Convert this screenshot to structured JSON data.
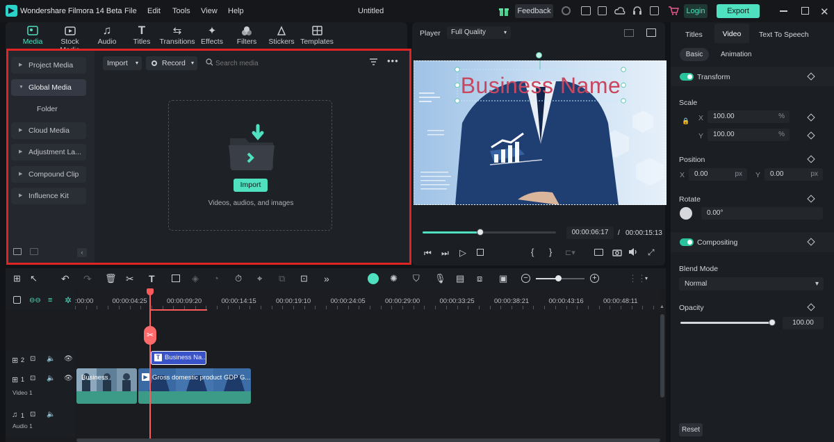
{
  "titlebar": {
    "app_title": "Wondershare Filmora 14 Beta",
    "menu": [
      "File",
      "Edit",
      "Tools",
      "View",
      "Help"
    ],
    "doc_title": "Untitled",
    "feedback": "Feedback",
    "login": "Login",
    "export": "Export"
  },
  "toolbar": {
    "tabs": [
      "Media",
      "Stock Media",
      "Audio",
      "Titles",
      "Transitions",
      "Effects",
      "Filters",
      "Stickers",
      "Templates"
    ]
  },
  "media": {
    "sidebar": [
      "Project Media",
      "Global Media",
      "Folder",
      "Cloud Media",
      "Adjustment La...",
      "Compound Clip",
      "Influence Kit"
    ],
    "import_dropdown": "Import",
    "record_dropdown": "Record",
    "search_placeholder": "Search media",
    "import_button": "Import",
    "drop_hint": "Videos, audios, and images"
  },
  "player": {
    "label": "Player",
    "quality": "Full Quality",
    "overlay_title": "Business Name",
    "current_time": "00:00:06:17",
    "separator": "/",
    "total_time": "00:00:15:13",
    "progress": 0.43
  },
  "props": {
    "tabs": [
      "Titles",
      "Video",
      "Text To Speech"
    ],
    "subtabs": [
      "Basic",
      "Animation"
    ],
    "transform": "Transform",
    "scale": "Scale",
    "scale_x_label": "X",
    "scale_x": "100.00",
    "scale_y_label": "Y",
    "scale_y": "100.00",
    "percent": "%",
    "position": "Position",
    "pos_x_label": "X",
    "pos_x": "0.00",
    "pos_y_label": "Y",
    "pos_y": "0.00",
    "px": "px",
    "rotate": "Rotate",
    "rotate_value": "0.00°",
    "compositing": "Compositing",
    "blend_mode": "Blend Mode",
    "blend_value": "Normal",
    "opacity": "Opacity",
    "opacity_value": "100.00",
    "reset": "Reset"
  },
  "timeline": {
    "ruler": [
      ":00:00",
      "00:00:04:25",
      "00:00:09:20",
      "00:00:14:15",
      "00:00:19:10",
      "00:00:24:05",
      "00:00:29:00",
      "00:00:33:25",
      "00:00:38:21",
      "00:00:43:16",
      "00:00:48:11"
    ],
    "title_clip": "Business Na...",
    "video_clip_a": "Business",
    "video_clip_b": "Gross domestic product GDP G...",
    "track_title_num": "2",
    "track_video_num": "1",
    "track_video_name": "Video 1",
    "track_audio_num": "1",
    "track_audio_name": "Audio 1"
  },
  "colors": {
    "accent": "#4fe0c0",
    "frame_red": "#e02323",
    "title_red": "#c8475e",
    "playhead": "#ff5a5a"
  }
}
